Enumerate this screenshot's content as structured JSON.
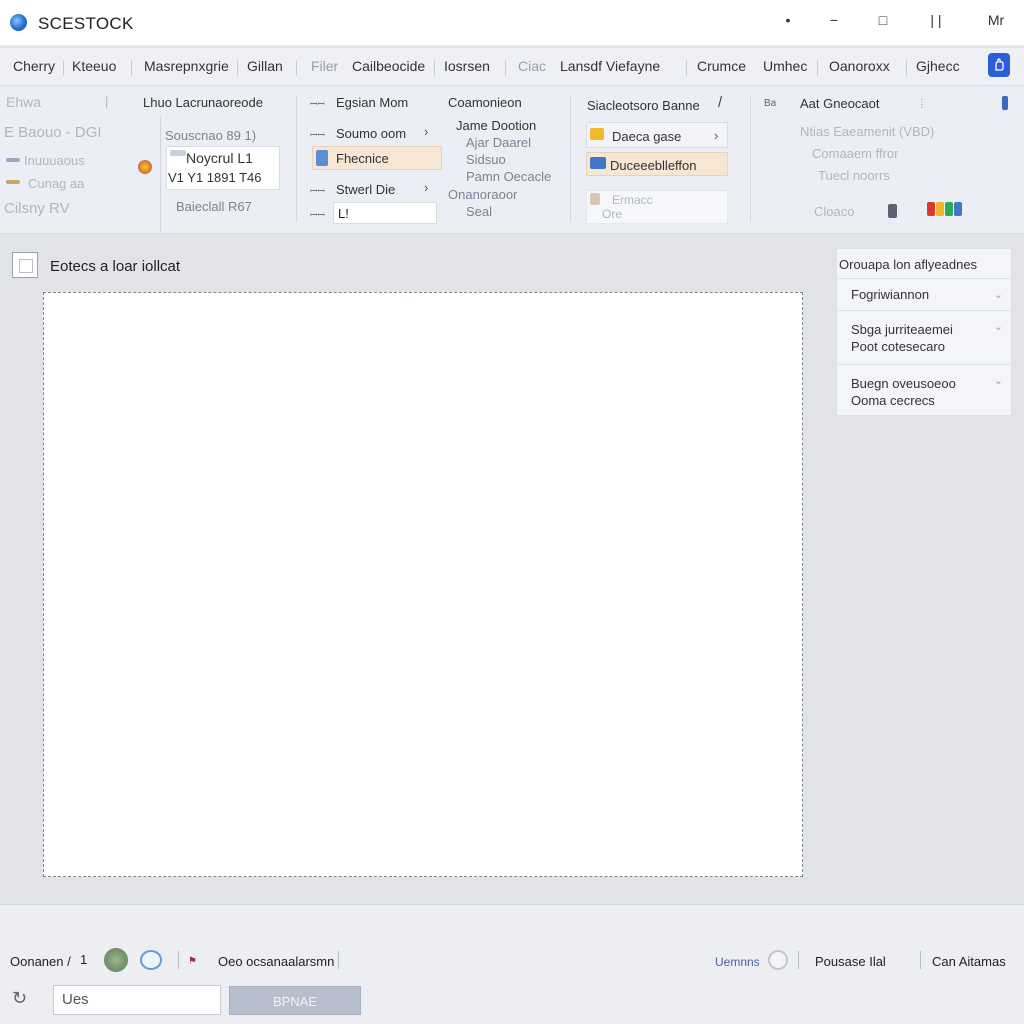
{
  "window": {
    "title": "SCESTOCK",
    "controls": [
      "•",
      "−",
      "□",
      "| |",
      "Mr"
    ]
  },
  "menu": {
    "tabs": [
      "Cherry",
      "Kteeuo",
      "Masrepnxgrie",
      "Gillan",
      "Filer",
      "Cailbeocide",
      "Iosrsen",
      "Ciac",
      "Lansdf Viefayne",
      "Crumce",
      "Umhec",
      "Oanoroxx",
      "Gjhecc"
    ]
  },
  "ribbon": {
    "g1": {
      "faint1": "Ehwa",
      "faint2": "E Baouo - DGI",
      "faint3": "Inuuuaous",
      "faint4": "Cunag aa",
      "faint5": "Cilsny  RV"
    },
    "g2": {
      "header": "Lhuo Lacrunaoreode",
      "line1": "Souscnao  89 1)",
      "selected_top": "Noycrul  L1",
      "selected_bottom": "V1  Y1 1891 T46",
      "footer": "Baieclall  R67"
    },
    "g3": {
      "line1": "Egsian Mom",
      "line2": "Soumo  oom",
      "highlight": "Fhecnice",
      "line3": "Stwerl  Die",
      "input_value": "L!"
    },
    "g4": {
      "header": "Coamonieon",
      "l1": "Jame Dootion",
      "l2": "Ajar Daarel",
      "l3": "Sidsuo",
      "l4": "Pamn Oecacle",
      "l5": "Onanoraoor",
      "l6": "Seal"
    },
    "g5": {
      "header": "Siacleotsoro Banne",
      "item1": "Daeca gase",
      "item2": "Duceeeblleffon",
      "item3": "Ermacc",
      "item4": "Ore"
    },
    "g6": {
      "header": "Aat Gneocaot",
      "faint1": "Ntias Eaeamenit (VBD)",
      "faint2": "Comaaem ffror",
      "faint3": "Tuecl noorrs",
      "footer": "Cloaco"
    }
  },
  "document": {
    "title": "Eotecs a loar  iollcat"
  },
  "side_panel": {
    "header": "Orouapa  lon  aflyeadnes",
    "items": [
      {
        "line1": "Fogriwiannon",
        "line2": ""
      },
      {
        "line1": "Sbga  jurriteaemei",
        "line2": "Poot  cotesecaro"
      },
      {
        "line1": "Buegn  oveusoeoo",
        "line2": "Ooma  cecrecs"
      }
    ]
  },
  "statusbar": {
    "left_label": "Oonanen /",
    "left_num": "1",
    "mid_text": "Oeo  ocsanaalarsmn",
    "right1": "Uemnns",
    "right2": "Pousase  Ilal",
    "right3": "Can Aitamas"
  },
  "bottom": {
    "input_value": "Ues",
    "button_label": "BPNAE"
  },
  "colors": {
    "accent": "#2b5fd9",
    "highlight": "#f7e6d4"
  }
}
